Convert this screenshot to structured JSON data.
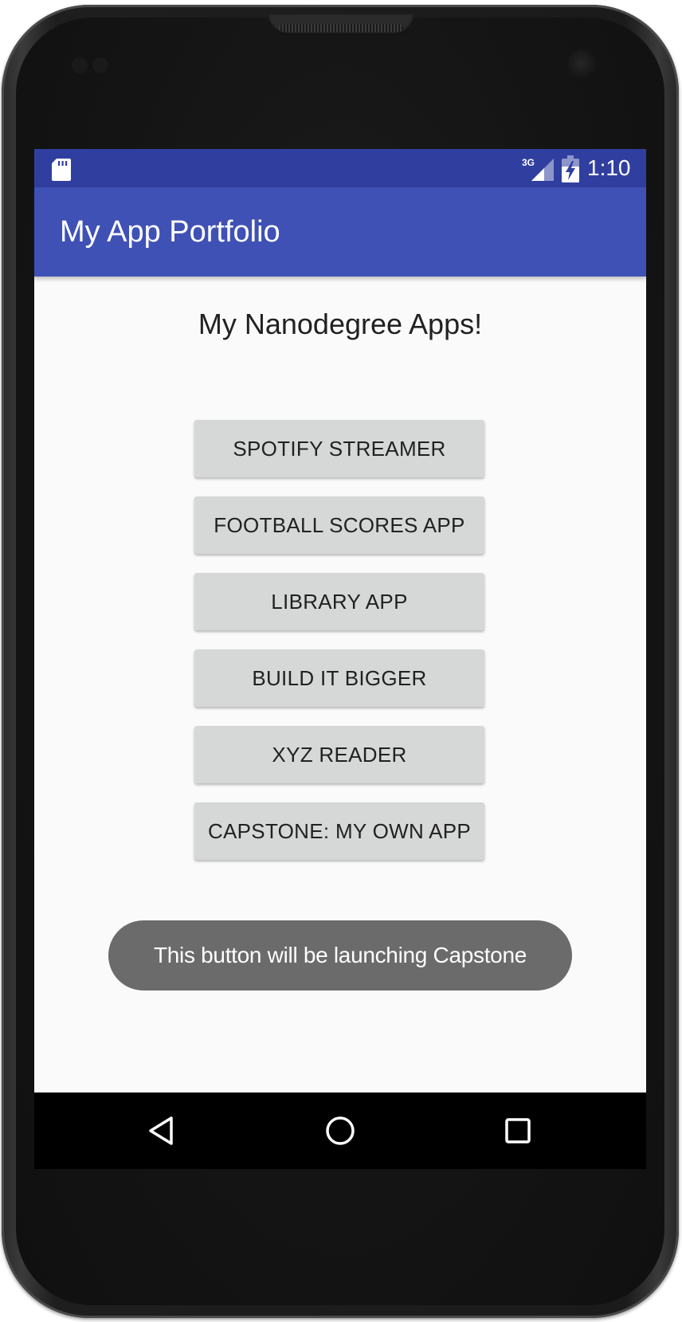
{
  "status_bar": {
    "time": "1:10",
    "network_label": "3G",
    "icons": [
      "sd-card-icon",
      "signal-icon",
      "battery-charging-icon"
    ]
  },
  "app_bar": {
    "title": "My App Portfolio"
  },
  "main": {
    "heading": "My Nanodegree Apps!",
    "buttons": [
      {
        "label": "SPOTIFY STREAMER"
      },
      {
        "label": "FOOTBALL SCORES APP"
      },
      {
        "label": "LIBRARY APP"
      },
      {
        "label": "BUILD IT BIGGER"
      },
      {
        "label": "XYZ READER"
      },
      {
        "label": "CAPSTONE: MY OWN APP"
      }
    ]
  },
  "toast": {
    "message": "This button will be launching Capstone"
  },
  "nav_bar": {
    "icons": [
      "back-icon",
      "home-icon",
      "recents-icon"
    ]
  },
  "colors": {
    "status_bar": "#303f9f",
    "app_bar": "#3f51b5",
    "button": "#d6d7d7",
    "toast": "#6b6b6b",
    "background": "#fafafa"
  }
}
